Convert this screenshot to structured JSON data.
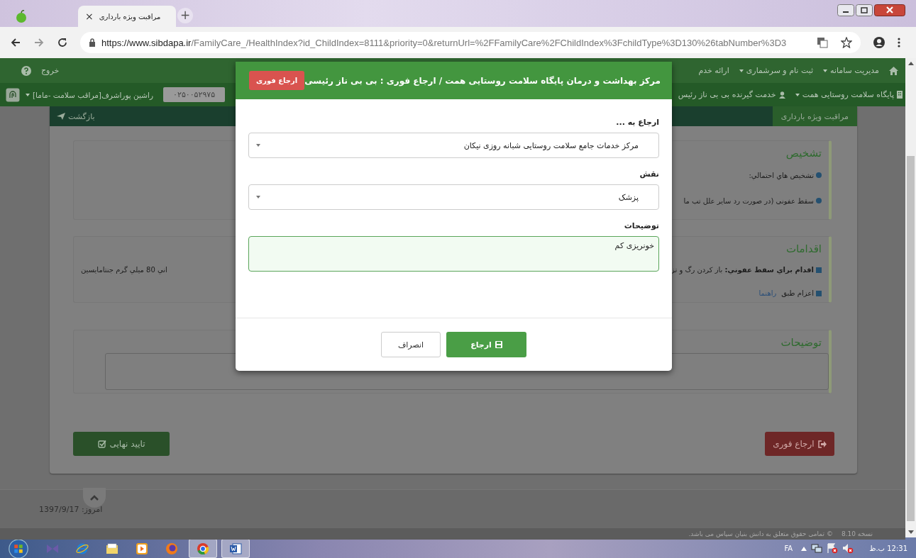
{
  "browser": {
    "tab_title": "مراقبت ویژه بارداری",
    "tab_close": "×",
    "new_tab": "+",
    "url_host": "https://www.sibdapa.ir",
    "url_path": "/FamilyCare_/HealthIndex?id_ChildIndex=8111&priority=0&returnUrl=%2FFamilyCare%2FChildIndex%3FchildType%3D130%26tabNumber%3D3"
  },
  "nav_primary": {
    "items": [
      {
        "label": "مدیریت سامانه",
        "dropdown": true
      },
      {
        "label": "ثبت نام و سرشماری",
        "dropdown": true
      },
      {
        "label": "ارائه خدم",
        "dropdown": false
      }
    ],
    "logout": "خروج"
  },
  "nav_secondary": {
    "items": [
      {
        "label": "پایگاه سلامت روستایی همت",
        "dropdown": true
      },
      {
        "label": "خدمت گیرنده بی بی ناز رئیس",
        "dropdown": false
      }
    ],
    "user": "راشین پوراشرف[مراقب سلامت -ماما]",
    "phone": "۰۲۵۰۰۵۲۹۷۵"
  },
  "page": {
    "tab": "مراقبت ویژه بارداری",
    "back": "بازگشت",
    "sections": [
      {
        "title": "تشخیص",
        "kind": "list",
        "items": [
          {
            "kind": "circle",
            "text": "تشخیص هاي احتمالي:"
          },
          {
            "kind": "circle",
            "text": "سقط عفونی (در صورت رد سایر علل تب ما"
          }
        ]
      },
      {
        "title": "اقدامات",
        "kind": "list",
        "items": [
          {
            "kind": "square",
            "text": "**اقدام براي سقط عفوني:** باز کردن رگ و تز",
            "aside": "اني 80 ميلي گرم جنتامايسين"
          },
          {
            "kind": "square",
            "text": "اعزام طبق",
            "link": "راهنما"
          }
        ]
      },
      {
        "title": "توضیحات",
        "kind": "textarea"
      }
    ],
    "confirm_button": "تایید نهایی",
    "refer_button": "ارجاع فوری"
  },
  "footer": {
    "date": "امروز: 1397/9/17",
    "version": "نسخه 8.10",
    "copyright": "© تمامی حقوق متعلق به دانش بنیان سپاس می باشد."
  },
  "modal": {
    "title": "مرکز بهداشت و درمان پایگاه سلامت روستایی همت / ارجاع فوری : بی بی ناز رئیسی",
    "badge": "ارجاع فوری",
    "fields": [
      {
        "label": "ارجاع به ...",
        "kind": "select",
        "value": "مرکز خدمات جامع سلامت روستایی شبانه روزی نیکان"
      },
      {
        "label": "نقش",
        "kind": "select",
        "value": "پزشک"
      },
      {
        "label": "توضیحات",
        "kind": "textarea",
        "value": "خونریزی کم"
      }
    ],
    "submit": "ارجاع",
    "cancel": "انصراف"
  },
  "taskbar": {
    "apps": [
      {
        "kind": "media",
        "active": false
      },
      {
        "kind": "ie",
        "active": false
      },
      {
        "kind": "folder",
        "active": false
      },
      {
        "kind": "player",
        "active": false
      },
      {
        "kind": "firefox",
        "active": false
      },
      {
        "kind": "chrome",
        "active": true
      },
      {
        "kind": "word",
        "active": true
      }
    ],
    "language": "FA",
    "clock": "12:31 ب.ظ"
  }
}
